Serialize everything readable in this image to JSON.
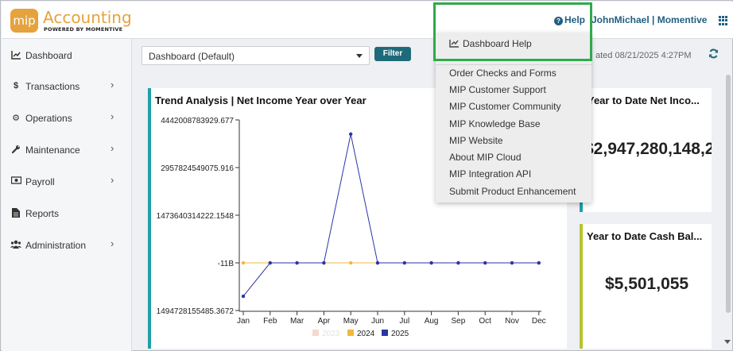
{
  "app": {
    "logo_badge": "mip",
    "title": "Accounting",
    "subtitle": "POWERED BY MOMENTIVE"
  },
  "header": {
    "help_label": "Help",
    "help_icon": "question-circle-icon",
    "user": "JohnMichael",
    "separator": "|",
    "company": "Momentive",
    "apps_icon": "grid-icon"
  },
  "sidebar": {
    "items": [
      {
        "label": "Dashboard",
        "icon": "chart-line-icon",
        "has_submenu": false
      },
      {
        "label": "Transactions",
        "icon": "dollar-icon",
        "has_submenu": true
      },
      {
        "label": "Operations",
        "icon": "cogs-icon",
        "has_submenu": true
      },
      {
        "label": "Maintenance",
        "icon": "wrench-icon",
        "has_submenu": true
      },
      {
        "label": "Payroll",
        "icon": "money-bill-icon",
        "has_submenu": true
      },
      {
        "label": "Reports",
        "icon": "file-icon",
        "has_submenu": false
      },
      {
        "label": "Administration",
        "icon": "users-icon",
        "has_submenu": true
      }
    ],
    "chevron": "›"
  },
  "toolbar": {
    "dashboard_select_value": "Dashboard (Default)",
    "filter_label": "Filter",
    "updated_text": "ated 08/21/2025 4:27PM",
    "refresh_icon": "refresh-icon"
  },
  "help_menu": {
    "items": [
      "Dashboard Help",
      "Order Checks and Forms",
      "MIP Customer Support",
      "MIP Customer Community",
      "MIP Knowledge Base",
      "MIP Website",
      "About MIP Cloud",
      "MIP Integration API",
      "Submit Product Enhancement"
    ]
  },
  "cards": {
    "net_income": {
      "title": "Year to Date Net Inco...",
      "value": "$2,947,280,148,2"
    },
    "cash": {
      "title": "Year to Date Cash Bal...",
      "value": "$5,501,055"
    }
  },
  "colors": {
    "accent": "#1f6a7a",
    "logo": "#e6a23c",
    "highlight": "#2eaa4b",
    "series_2023": "#f5d8cf",
    "series_2024": "#f0b840",
    "series_2025": "#2a35a8"
  },
  "chart_data": {
    "type": "line",
    "title": "Trend Analysis | Net Income Year over Year",
    "categories": [
      "Jan",
      "Feb",
      "Mar",
      "Apr",
      "May",
      "Jun",
      "Jul",
      "Aug",
      "Sep",
      "Oct",
      "Nov",
      "Dec"
    ],
    "y_ticks": [
      "4442008783929.677",
      "2957824549075.916",
      "1473640314222.1548",
      "-11B",
      "1494728155485.3672"
    ],
    "ylim": [
      -1494728155485.3672,
      4442008783929.677
    ],
    "series": [
      {
        "name": "2023",
        "color": "#f5d8cf",
        "values": []
      },
      {
        "name": "2024",
        "color": "#f0b840",
        "values": [
          -11000000000,
          -11000000000,
          -11000000000,
          -11000000000,
          -11000000000,
          -11000000000,
          -11000000000,
          -11000000000,
          -11000000000,
          -11000000000,
          -11000000000,
          -11000000000
        ]
      },
      {
        "name": "2025",
        "color": "#2a35a8",
        "values": [
          -1050000000000,
          -11000000000,
          -11000000000,
          -11000000000,
          4000000000000,
          -11000000000,
          -11000000000,
          -11000000000,
          -11000000000,
          -11000000000,
          -11000000000,
          -11000000000
        ]
      }
    ],
    "legend_position": "bottom"
  }
}
